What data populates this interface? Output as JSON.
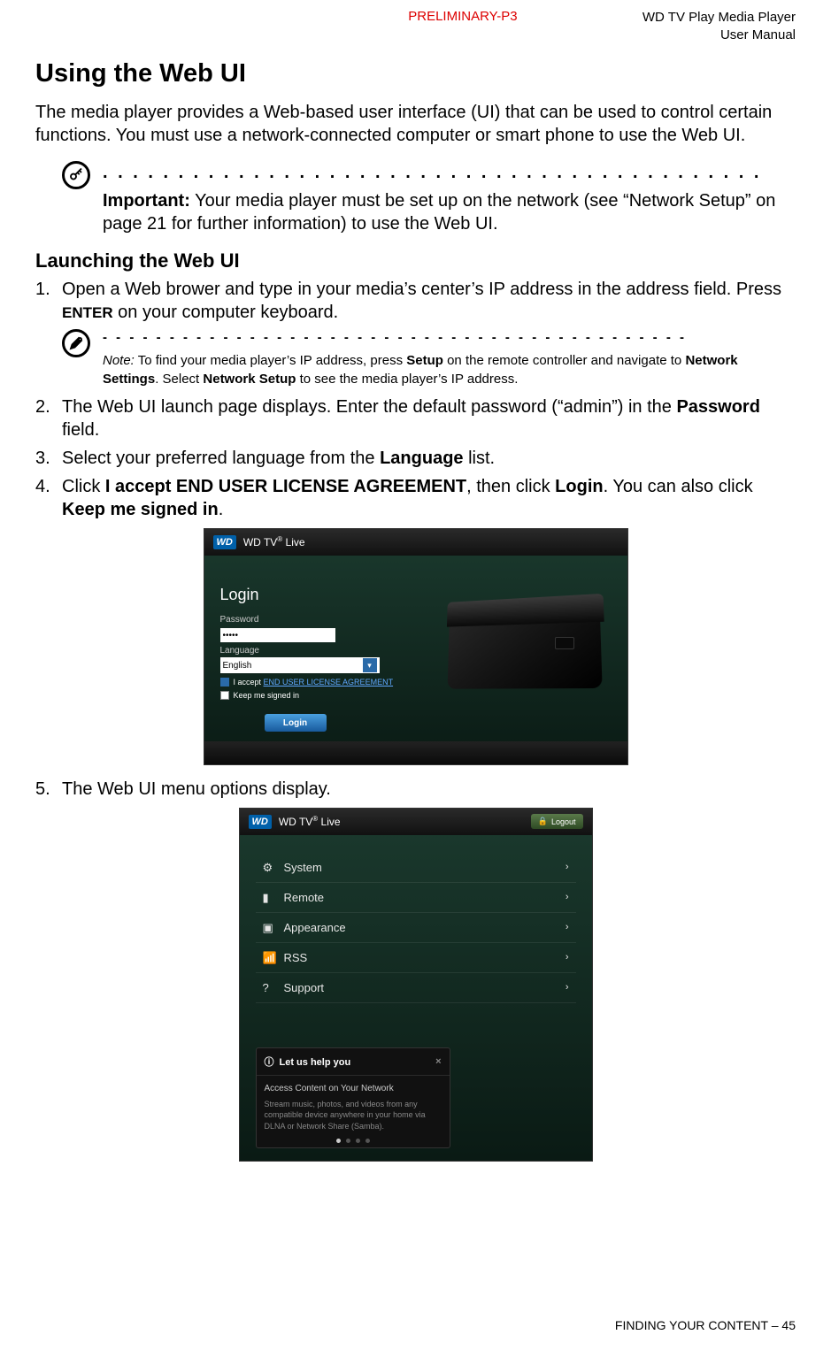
{
  "header": {
    "preliminary": "PRELIMINARY-P3",
    "manual_line1": "WD TV Play Media Player",
    "manual_line2": "User Manual"
  },
  "h1": "Using the Web UI",
  "intro": "The media player provides a Web-based user interface (UI) that can be used to control certain functions. You must use a network-connected computer or smart phone to use the Web UI.",
  "important": {
    "label": "Important:",
    "text": " Your media player must be set up on the network (see “Network Setup” on page 21 for further information) to use the Web UI."
  },
  "h2": "Launching the Web UI",
  "steps": {
    "s1a": "Open a Web brower and type in your media’s center’s IP address in the address field. Press ",
    "s1b": "ENTER",
    "s1c": " on your computer keyboard.",
    "note_label": "Note:",
    "note_a": " To find your media player’s IP address, press ",
    "note_b": "Setup",
    "note_c": " on the remote controller and navigate to ",
    "note_d": "Network Settings",
    "note_e": ". Select ",
    "note_f": "Network Setup",
    "note_g": " to see the media player’s IP address.",
    "s2a": "The Web UI launch page displays. Enter the default password (“admin”) in the ",
    "s2b": "Password",
    "s2c": " field.",
    "s3a": "Select your preferred language from the ",
    "s3b": "Language",
    "s3c": " list.",
    "s4a": "Click ",
    "s4b": "I accept END USER LICENSE AGREEMENT",
    "s4c": ", then click ",
    "s4d": "Login",
    "s4e": ". You can also click ",
    "s4f": "Keep me signed in",
    "s4g": ".",
    "s5": "The Web UI menu options display."
  },
  "fig1": {
    "brand_badge": "WD",
    "brand_text": "WD TV",
    "brand_suffix": " Live",
    "login_heading": "Login",
    "pw_label": "Password",
    "pw_value": "•••••",
    "lang_label": "Language",
    "lang_value": "English",
    "accept_prefix": "I accept ",
    "eula": "END USER LICENSE AGREEMENT",
    "keep": "Keep me signed in",
    "login_btn": "Login"
  },
  "fig2": {
    "brand_badge": "WD",
    "brand_text": "WD TV",
    "brand_suffix": " Live",
    "logout": "Logout",
    "menu": [
      "System",
      "Remote",
      "Appearance",
      "RSS",
      "Support"
    ],
    "help_title": "Let us help you",
    "help_sub": "Access Content on Your Network",
    "help_body": "Stream music, photos, and videos from any compatible device anywhere in your home via DLNA or Network Share (Samba)."
  },
  "footer": {
    "section": "FINDING YOUR CONTENT",
    "sep": " – ",
    "page": "45"
  }
}
